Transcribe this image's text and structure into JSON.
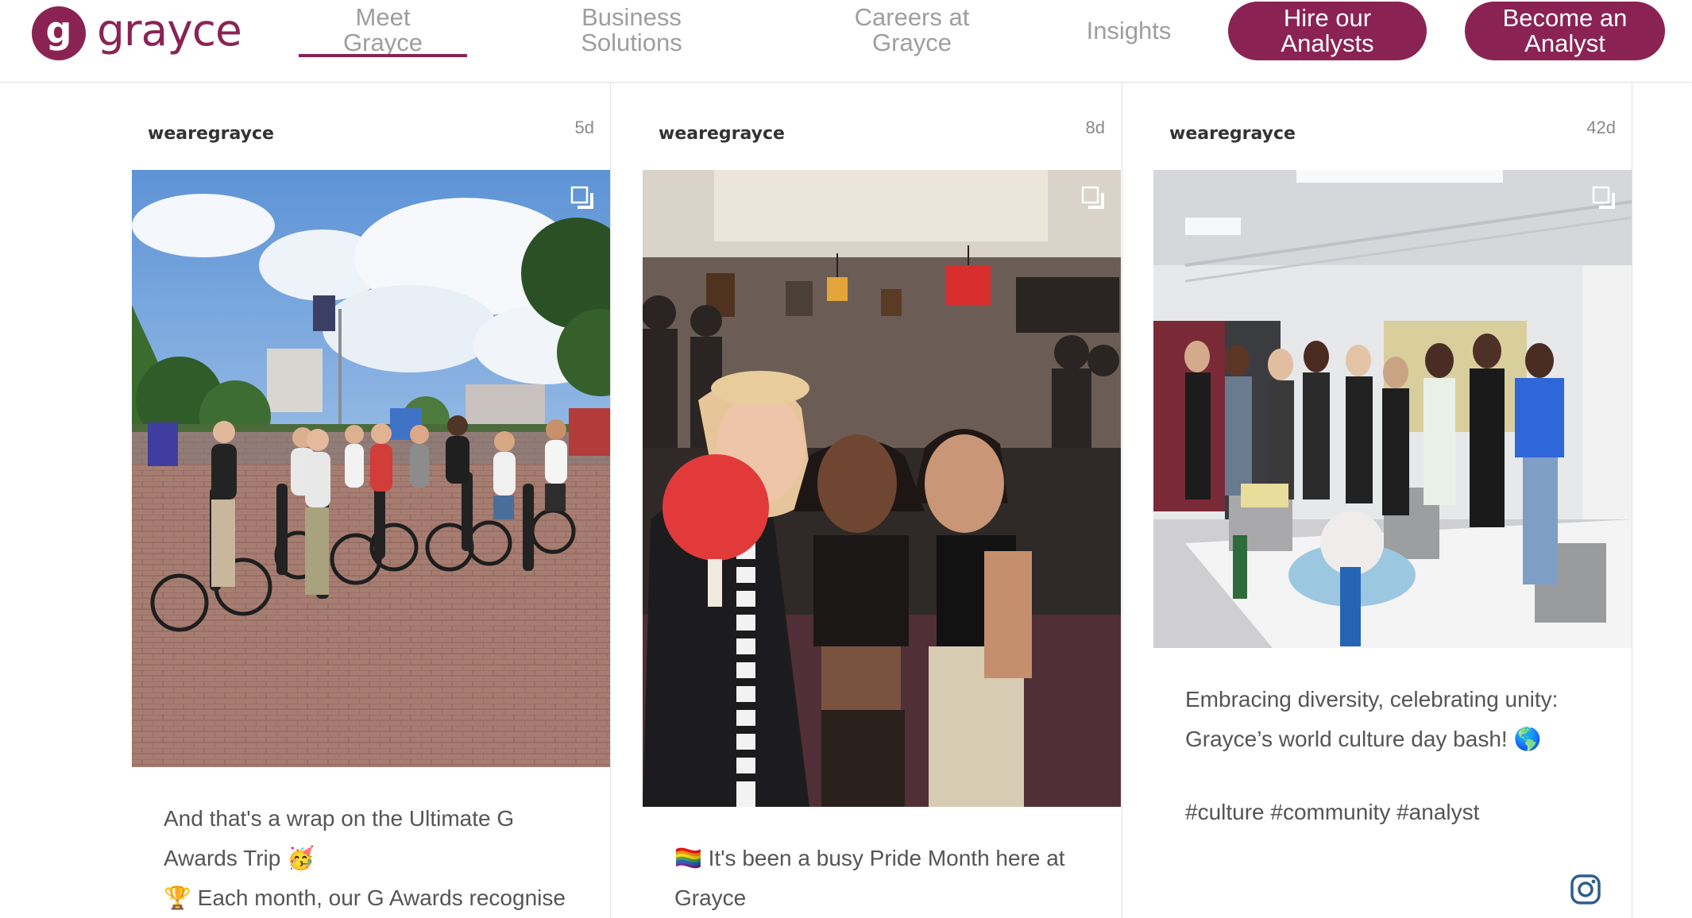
{
  "brand": {
    "logo_text": "grayce",
    "logo_glyph": "g",
    "accent_color": "#8a2354"
  },
  "nav": {
    "meet": {
      "line1": "Meet",
      "line2": "Grayce",
      "active": true
    },
    "business": {
      "line1": "Business",
      "line2": "Solutions"
    },
    "careers": {
      "line1": "Careers at",
      "line2": "Grayce"
    },
    "insights": {
      "label": "Insights"
    },
    "hire": {
      "line1": "Hire our",
      "line2": "Analysts"
    },
    "become": {
      "line1": "Become an",
      "line2": "Analyst"
    }
  },
  "posts": [
    {
      "username": "wearegrayce",
      "age": "5d",
      "photo_icon": "multiple-images-icon",
      "caption": [
        "And that's a wrap on the Ultimate G",
        "Awards Trip 🥳",
        "🏆 Each month, our G Awards recognise"
      ]
    },
    {
      "username": "wearegrayce",
      "age": "8d",
      "photo_icon": "multiple-images-icon",
      "caption": [
        "🏳️‍🌈 It's been a busy Pride Month here at",
        "Grayce"
      ]
    },
    {
      "username": "wearegrayce",
      "age": "42d",
      "photo_icon": "multiple-images-icon",
      "caption": [
        "Embracing diversity, celebrating unity:",
        "Grayce’s world culture day bash! 🌎",
        "#culture #community #analyst"
      ],
      "footer_icon": "instagram-icon"
    }
  ]
}
